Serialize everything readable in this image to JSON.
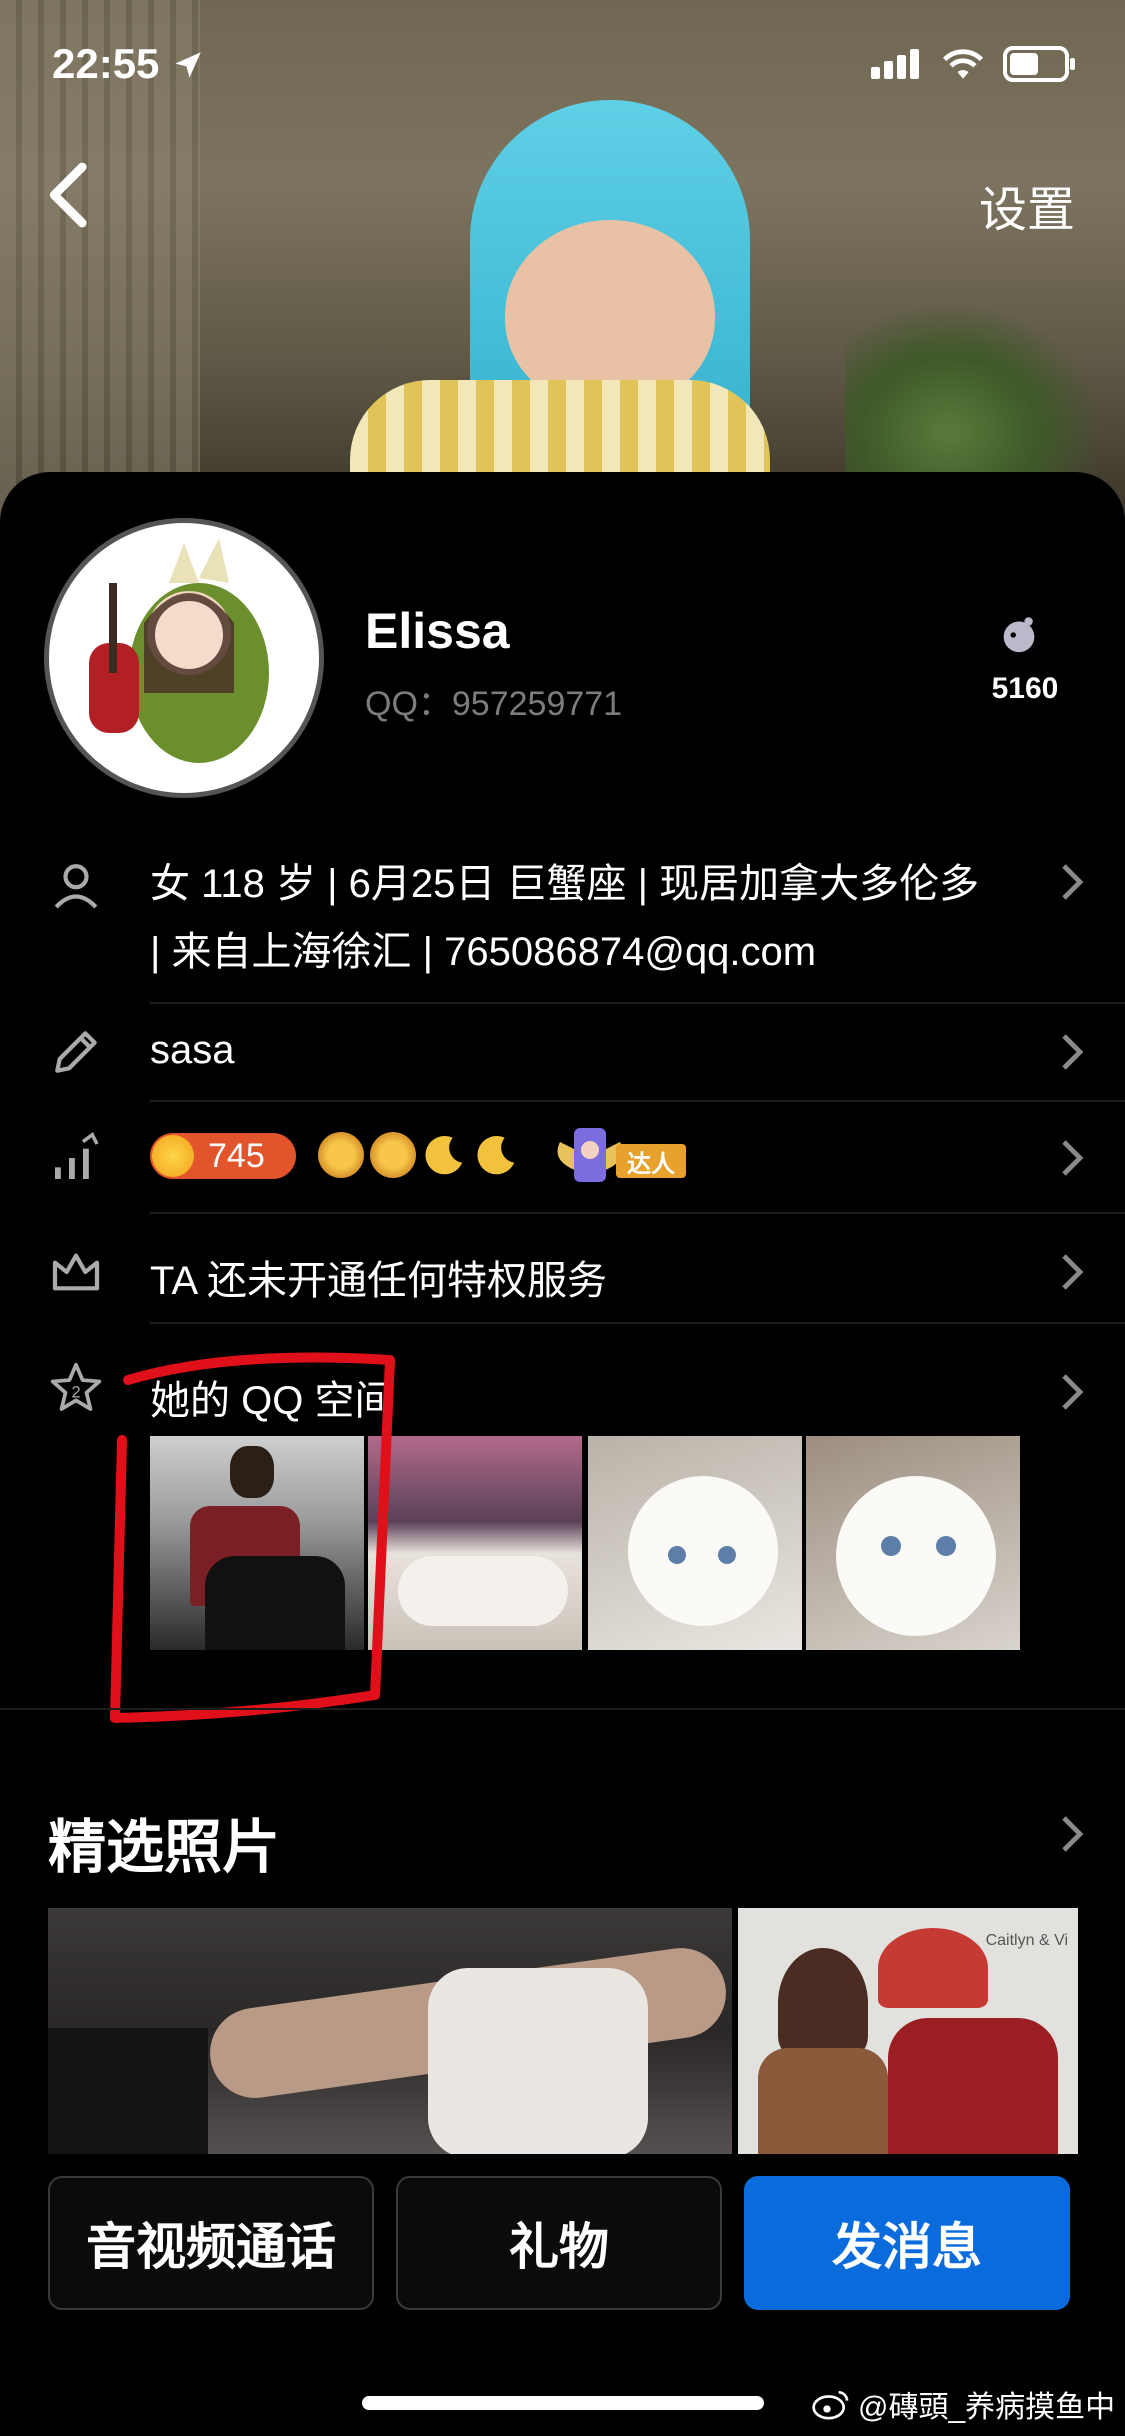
{
  "status_bar": {
    "time": "22:55"
  },
  "header": {
    "settings_label": "设置"
  },
  "profile": {
    "name": "Elissa",
    "qq": "QQ：957259771",
    "likes": "5160"
  },
  "info": {
    "text": "女 118 岁 | 6月25日 巨蟹座 | 现居加拿大多伦多 | 来自上海徐汇 | 765086874@qq.com"
  },
  "signature": "sasa",
  "level": {
    "badge_value": "745",
    "expert_badge": "达人"
  },
  "privilege": "TA 还未开通任何特权服务",
  "qzone": {
    "title": "她的 QQ 空间"
  },
  "featured": {
    "title": "精选照片",
    "photo_caption": "Caitlyn & Vi"
  },
  "actions": {
    "call": "音视频通话",
    "gift": "礼物",
    "message": "发消息"
  },
  "watermark": "@磚頭_养病摸鱼中",
  "colors": {
    "accent": "#0a6cdc",
    "annotation": "#e0101a",
    "level_badge": "#e2552c"
  },
  "icons": [
    "location-arrow-icon",
    "signal-icon",
    "wifi-icon",
    "battery-icon",
    "back-chevron-icon",
    "like-icon",
    "person-icon",
    "pencil-icon",
    "level-chart-icon",
    "crown-icon",
    "star-icon",
    "chevron-right-icon",
    "weibo-icon"
  ]
}
